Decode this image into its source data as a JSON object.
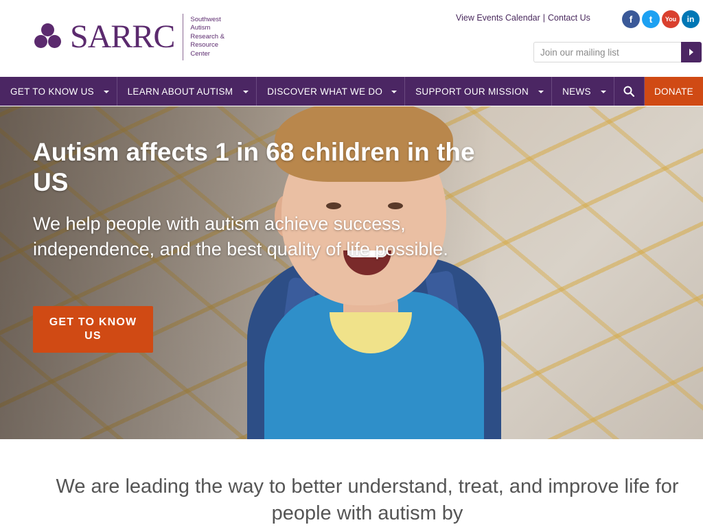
{
  "brand": {
    "name": "SARRC",
    "subtitle_lines": [
      "Southwest",
      "Autism",
      "Research &",
      "Resource",
      "Center"
    ],
    "color": "#5b2a6e"
  },
  "top_links": {
    "events": "View Events Calendar",
    "separator": "|",
    "contact": "Contact Us"
  },
  "social": [
    {
      "icon": "facebook-icon",
      "glyph": "f",
      "color": "#3b5998"
    },
    {
      "icon": "twitter-icon",
      "glyph": "t",
      "color": "#1da1f2"
    },
    {
      "icon": "youtube-icon",
      "glyph": "You",
      "color": "#d9402e"
    },
    {
      "icon": "linkedin-icon",
      "glyph": "in",
      "color": "#0077b5"
    }
  ],
  "mailing": {
    "placeholder": "Join our mailing list"
  },
  "nav": {
    "items": [
      {
        "label": "GET TO KNOW US"
      },
      {
        "label": "LEARN ABOUT AUTISM"
      },
      {
        "label": "DISCOVER WHAT WE DO"
      },
      {
        "label": "SUPPORT OUR MISSION"
      },
      {
        "label": "NEWS"
      }
    ],
    "donate_label": "DONATE",
    "color": "#4b2663",
    "donate_color": "#d04a14"
  },
  "hero": {
    "title": "Autism affects 1 in 68 children in the US",
    "subtitle": "We help people with autism achieve success, independence, and the best quality of life possible.",
    "cta_label": "GET TO KNOW US"
  },
  "tagline": "We are leading the way to better understand, treat, and improve life for people with autism by"
}
